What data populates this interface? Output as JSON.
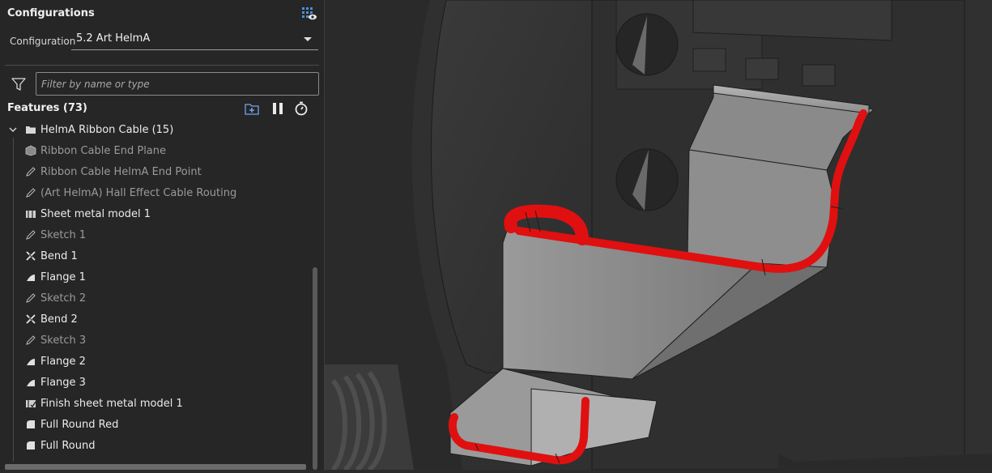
{
  "configurations": {
    "title": "Configurations",
    "label": "Configuration",
    "selected": "5.2 Art HelmA",
    "icon": "config-grid-eye-icon"
  },
  "filter": {
    "placeholder": "Filter by name or type",
    "icon": "filter-funnel-icon"
  },
  "features": {
    "header": "Features (73)",
    "toolbar": [
      "add-folder-icon",
      "pause-icon",
      "stopwatch-icon"
    ],
    "items": [
      {
        "label": "HelmA Ribbon Cable (15)",
        "icon": "folder-icon",
        "type": "folder",
        "dim": false
      },
      {
        "label": "Ribbon Cable End Plane",
        "icon": "plane-icon",
        "dim": true
      },
      {
        "label": "Ribbon Cable HelmA End Point",
        "icon": "sketch-icon",
        "dim": true
      },
      {
        "label": "(Art HelmA) Hall Effect Cable Routing",
        "icon": "sketch-icon",
        "dim": true
      },
      {
        "label": "Sheet metal model 1",
        "icon": "sheet-metal-icon",
        "dim": false
      },
      {
        "label": "Sketch 1",
        "icon": "sketch-icon",
        "dim": true
      },
      {
        "label": "Bend 1",
        "icon": "bend-icon",
        "dim": false
      },
      {
        "label": "Flange 1",
        "icon": "flange-icon",
        "dim": false
      },
      {
        "label": "Sketch 2",
        "icon": "sketch-icon",
        "dim": true
      },
      {
        "label": "Bend 2",
        "icon": "bend-icon",
        "dim": false
      },
      {
        "label": "Sketch 3",
        "icon": "sketch-icon",
        "dim": true
      },
      {
        "label": "Flange 2",
        "icon": "flange-icon",
        "dim": false
      },
      {
        "label": "Flange 3",
        "icon": "flange-icon",
        "dim": false
      },
      {
        "label": "Finish sheet metal model 1",
        "icon": "finish-sheet-metal-icon",
        "dim": false
      },
      {
        "label": "Full Round Red",
        "icon": "fillet-icon",
        "dim": false
      },
      {
        "label": "Full Round",
        "icon": "fillet-icon",
        "dim": false
      }
    ]
  },
  "colors": {
    "panel_bg": "#262626",
    "viewport_bg": "#333333",
    "highlight_red": "#e01010",
    "part_gray": "#8c8c8c"
  }
}
